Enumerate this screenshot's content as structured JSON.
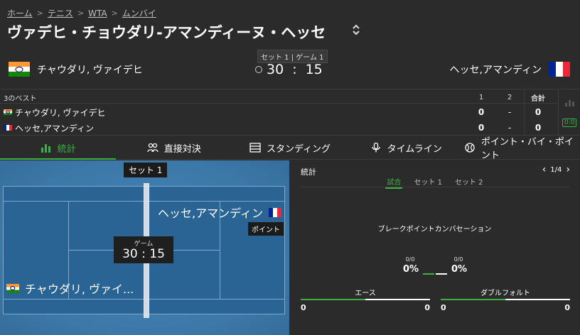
{
  "breadcrumb": [
    "ホーム",
    "テニス",
    "WTA",
    "ムンバイ"
  ],
  "title": "ヴァデヒ・チョウダリ-アマンディーヌ・ヘッセ",
  "title_toggle": "⌃⌄",
  "player1": {
    "name": "チャウダリ, ヴァイデヒ",
    "flag": "india"
  },
  "player2": {
    "name": "ヘッセ,アマンディン",
    "flag": "france"
  },
  "score": {
    "meta": "セット 1 | ゲーム 1",
    "p1": "30",
    "sep": ":",
    "p2": "15"
  },
  "scoretable": {
    "label": "3のベスト",
    "col1": "1",
    "col2": "2",
    "total": "合計",
    "rows": [
      {
        "name": "チャウダリ, ヴァイデヒ",
        "s1": "0",
        "s2": "-",
        "total": "0"
      },
      {
        "name": "ヘッセ,アマンディン",
        "s1": "0",
        "s2": "-",
        "total": "0"
      }
    ],
    "od_label": "0:0"
  },
  "tabs": [
    {
      "label": "統計",
      "icon": "bar-chart-icon",
      "active": true
    },
    {
      "label": "直接対決",
      "icon": "people-icon",
      "active": false
    },
    {
      "label": "スタンディング",
      "icon": "list-icon",
      "active": false
    },
    {
      "label": "タイムライン",
      "icon": "microphone-icon",
      "active": false
    },
    {
      "label": "ポイント・バイ・ポイント",
      "icon": "tennis-ball-icon",
      "active": false
    }
  ],
  "court": {
    "set_label": "セット 1",
    "p2_name": "ヘッセ,アマンディン",
    "point_label": "ポイント",
    "game_label": "ゲーム",
    "game_score": "30 : 15",
    "p1_name": "チャウダリ, ヴァイ..."
  },
  "stats": {
    "title": "統計",
    "pager": "1/4",
    "tabs": [
      "試合",
      "セット 1",
      "セット 2"
    ],
    "bp_label": "ブレークポイントカンバセーション",
    "bp_p1_small": "0/0",
    "bp_p1_pct": "0%",
    "bp_p2_small": "0/0",
    "bp_p2_pct": "0%",
    "aces": {
      "label": "エース",
      "p1": "0",
      "p2": "0",
      "p1_share": 0.5
    },
    "double_faults": {
      "label": "ダブルフォルト",
      "p1": "0",
      "p2": "0",
      "p1_share": 0.5
    }
  },
  "colors": {
    "accent": "#3cb043",
    "background": "#2b2b2b",
    "court": "#2a6494"
  }
}
